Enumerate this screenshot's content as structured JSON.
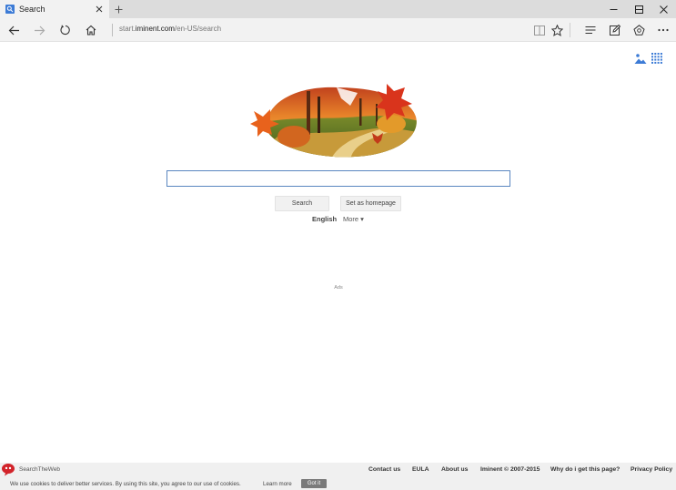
{
  "browser": {
    "tab_title": "Search",
    "url_prefix": "start.",
    "url_domain": "iminent.com",
    "url_path": "/en-US/search"
  },
  "icons": {
    "tab_favicon": "search-icon",
    "tab_close": "close-icon",
    "new_tab": "plus-icon",
    "minimize": "minimize-icon",
    "maximize": "maximize-icon",
    "close_window": "close-icon",
    "back": "back-arrow-icon",
    "forward": "forward-arrow-icon",
    "refresh": "refresh-icon",
    "home": "home-icon",
    "reading_view": "book-icon",
    "favorite": "star-icon",
    "hub": "hub-icon",
    "web_note": "pen-icon",
    "share": "share-icon",
    "more": "more-icon",
    "background_picker": "image-icon",
    "apps": "grid-icon",
    "logo": "autumn-leaves-logo",
    "footer_logo": "searchtheweb-logo"
  },
  "search": {
    "value": "",
    "search_button": "Search",
    "homepage_button": "Set as homepage",
    "language": "English",
    "more": "More ▾"
  },
  "ads_label": "Ads",
  "footer": {
    "brand": "SearchTheWeb",
    "links": [
      "Contact us",
      "EULA",
      "About us",
      "Iminent © 2007-2015",
      "Why do i get this page?",
      "Privacy Policy"
    ],
    "cookie_text": "We use cookies to deliver better services. By using this site, you agree to our use of cookies.",
    "learn_more": "Learn more",
    "got_it": "Got it"
  },
  "colors": {
    "accent_blue": "#3c7bd6",
    "search_border": "#5a86c0",
    "footer_bg": "#f0f0f0",
    "got_it_bg": "#7a7a7a"
  }
}
